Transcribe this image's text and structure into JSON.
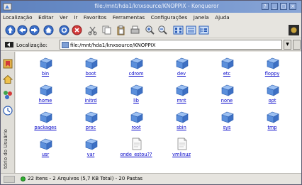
{
  "window": {
    "title": "file:/mnt/hda1/knxsource/KNOPPIX - Konqueror",
    "controls": [
      "?",
      "_",
      "□",
      "×"
    ]
  },
  "menu": [
    "Localização",
    "Editar",
    "Ver",
    "Ir",
    "Favoritos",
    "Ferramentas",
    "Configurações",
    "Janela",
    "Ajuda"
  ],
  "toolbar": {
    "icons": [
      "up-arrow-icon",
      "back-arrow-icon",
      "forward-arrow-icon",
      "home-icon",
      "reload-icon",
      "stop-icon",
      "cut-icon",
      "copy-icon",
      "paste-icon",
      "print-icon",
      "zoom-in-icon",
      "zoom-out-icon",
      "view-icon-mode-icon",
      "view-list-mode-icon",
      "view-tree-mode-icon"
    ]
  },
  "location": {
    "label": "Localização:",
    "value": "file:/mnt/hda1/knxsource/KNOPPIX"
  },
  "sidebar": {
    "vertical_label": "tório do Usuário"
  },
  "files": [
    {
      "name": "bin",
      "kind": "folder"
    },
    {
      "name": "boot",
      "kind": "folder"
    },
    {
      "name": "cdrom",
      "kind": "folder"
    },
    {
      "name": "dev",
      "kind": "folder"
    },
    {
      "name": "etc",
      "kind": "folder"
    },
    {
      "name": "floppy",
      "kind": "folder"
    },
    {
      "name": "home",
      "kind": "folder"
    },
    {
      "name": "initrd",
      "kind": "folder"
    },
    {
      "name": "lib",
      "kind": "folder"
    },
    {
      "name": "mnt",
      "kind": "folder"
    },
    {
      "name": "none",
      "kind": "folder"
    },
    {
      "name": "opt",
      "kind": "folder"
    },
    {
      "name": "packages",
      "kind": "folder"
    },
    {
      "name": "proc",
      "kind": "folder"
    },
    {
      "name": "root",
      "kind": "folder"
    },
    {
      "name": "sbin",
      "kind": "folder"
    },
    {
      "name": "sys",
      "kind": "folder"
    },
    {
      "name": "tmp",
      "kind": "folder"
    },
    {
      "name": "usr",
      "kind": "folder"
    },
    {
      "name": "var",
      "kind": "folder"
    },
    {
      "name": "onde_estou??",
      "kind": "file"
    },
    {
      "name": "vmlinuz",
      "kind": "file"
    }
  ],
  "status": {
    "text": "22 Itens - 2 Arquivos (5,7 KB Total) - 20 Pastas"
  },
  "colors": {
    "titlebar": "#6b8fcb",
    "link": "#0000c8",
    "folder": "#4a7fd4",
    "status_led": "#2fb02f"
  }
}
